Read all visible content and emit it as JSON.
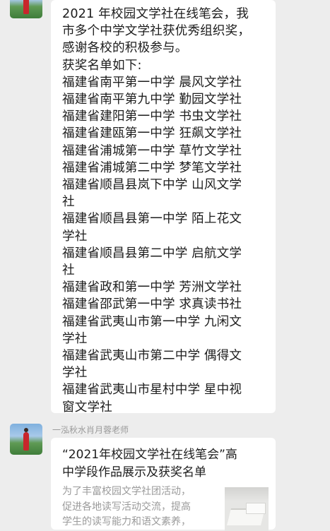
{
  "message1": {
    "intro": [
      "2021 年校园文学社在线笔会，我",
      "市多个中学文学社获优秀组织奖，",
      "感谢各校的积极参与。"
    ],
    "list_heading": "获奖名单如下:",
    "winners": [
      [
        "福建省南平第一中学 晨风文学社"
      ],
      [
        "福建省南平第九中学 勤园文学社"
      ],
      [
        "福建省建阳第一中学 书虫文学社"
      ],
      [
        "福建省建瓯第一中学 狂飙文学社"
      ],
      [
        "福建省浦城第一中学 草竹文学社"
      ],
      [
        "福建省浦城第二中学 梦笔文学社"
      ],
      [
        "福建省顺昌县岚下中学 山风文学",
        "社"
      ],
      [
        "福建省顺昌县第一中学 陌上花文",
        "学社"
      ],
      [
        "福建省顺昌县第二中学 启航文学",
        "社"
      ],
      [
        "福建省政和第一中学 芳洲文学社"
      ],
      [
        "福建省邵武第一中学 求真读书社"
      ],
      [
        "福建省武夷山市第一中学 九闲文",
        "学社"
      ],
      [
        "福建省武夷山市第二中学 偶得文",
        "学社"
      ],
      [
        "福建省武夷山市星村中学 星中视",
        "窗文学社"
      ]
    ]
  },
  "message2": {
    "sender": "一泓秋水肖月蓉老师",
    "card_title_lines": [
      "“2021年校园文学社在线笔会”高",
      "中学段作品展示及获奖名单"
    ],
    "card_desc_lines": [
      "为了丰富校园文学社团活动，",
      "促进各地读写活动交流，提高",
      "学生的读写能力和语文素养，"
    ]
  }
}
